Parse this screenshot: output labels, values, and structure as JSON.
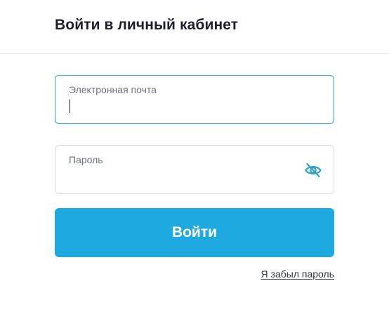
{
  "header": {
    "title": "Войти в личный кабинет"
  },
  "form": {
    "email_label": "Электронная почта",
    "email_value": "",
    "password_label": "Пароль",
    "password_value": "",
    "password_toggle_icon": "eye-slash-icon",
    "submit_label": "Войти",
    "forgot_label": "Я забыл пароль"
  },
  "colors": {
    "accent": "#1eaae0",
    "focus_border": "#2aa7d6",
    "icon": "#2ba1cc"
  }
}
